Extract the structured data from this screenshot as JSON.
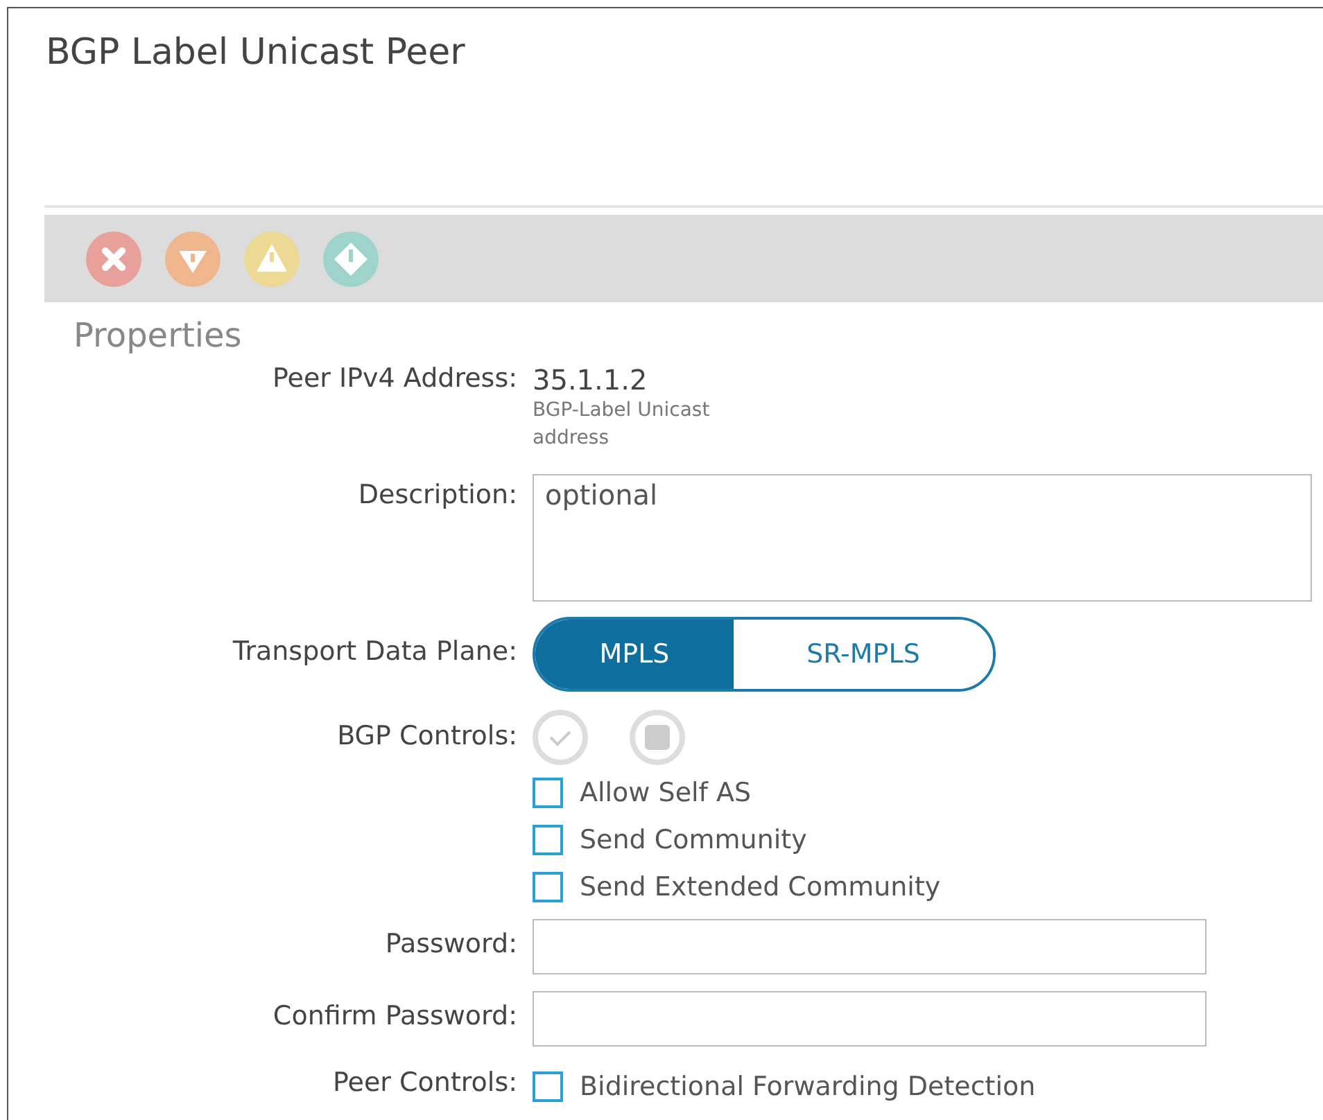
{
  "title": "BGP Label Unicast Peer",
  "faults": [
    {
      "kind": "critical",
      "color": "#e8a09a"
    },
    {
      "kind": "major",
      "color": "#efb58c"
    },
    {
      "kind": "minor",
      "color": "#ecd993"
    },
    {
      "kind": "warning",
      "color": "#9ed3cc"
    }
  ],
  "section": "Properties",
  "fields": [
    {
      "kind": "text",
      "label": "Peer IPv4 Address:",
      "value": "35.1.1.2",
      "hint": "BGP-Label Unicast address"
    },
    {
      "kind": "textarea",
      "label": "Description:",
      "placeholder": "optional"
    },
    {
      "kind": "toggle",
      "label": "Transport Data Plane:",
      "options": [
        {
          "label": "MPLS",
          "selected": true
        },
        {
          "label": "SR-MPLS",
          "selected": false
        }
      ]
    },
    {
      "kind": "checks",
      "label": "BGP Controls:",
      "bulk": true,
      "items": [
        {
          "label": "Allow Self AS",
          "checked": false
        },
        {
          "label": "Send Community",
          "checked": false
        },
        {
          "label": "Send Extended Community",
          "checked": false
        }
      ]
    },
    {
      "kind": "input",
      "label": "Password:"
    },
    {
      "kind": "input",
      "label": "Confirm Password:"
    },
    {
      "kind": "checks",
      "label": "Peer Controls:",
      "bulk": false,
      "items": [
        {
          "label": "Bidirectional Forwarding Detection",
          "checked": false
        }
      ]
    }
  ]
}
